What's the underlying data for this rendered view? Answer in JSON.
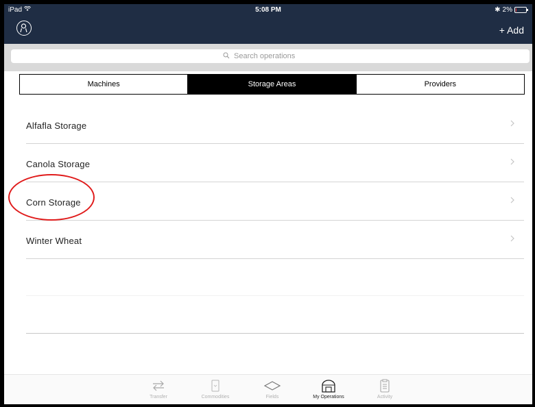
{
  "status_bar": {
    "device": "iPad",
    "time": "5:08 PM",
    "battery": "2%"
  },
  "nav": {
    "add_label": "+ Add"
  },
  "search": {
    "placeholder": "Search operations",
    "value": ""
  },
  "segments": [
    {
      "label": "Machines",
      "active": false
    },
    {
      "label": "Storage Areas",
      "active": true
    },
    {
      "label": "Providers",
      "active": false
    }
  ],
  "list": {
    "items": [
      {
        "label": "Alfafla Storage"
      },
      {
        "label": "Canola Storage"
      },
      {
        "label": "Corn Storage",
        "annotated": true
      },
      {
        "label": "Winter Wheat"
      }
    ]
  },
  "annotation": {
    "color": "#e01b1b",
    "target": "Corn Storage"
  },
  "tabs": [
    {
      "label": "Transfer",
      "icon": "transfer-arrows-icon"
    },
    {
      "label": "Commodities",
      "icon": "commodities-icon"
    },
    {
      "label": "Fields",
      "icon": "field-diamond-icon"
    },
    {
      "label": "My Operations",
      "icon": "barn-icon",
      "active": true
    },
    {
      "label": "Activity",
      "icon": "clipboard-icon"
    }
  ],
  "colors": {
    "header_bg": "#1f2d44",
    "active_segment_bg": "#000000",
    "annotation": "#e01b1b"
  }
}
